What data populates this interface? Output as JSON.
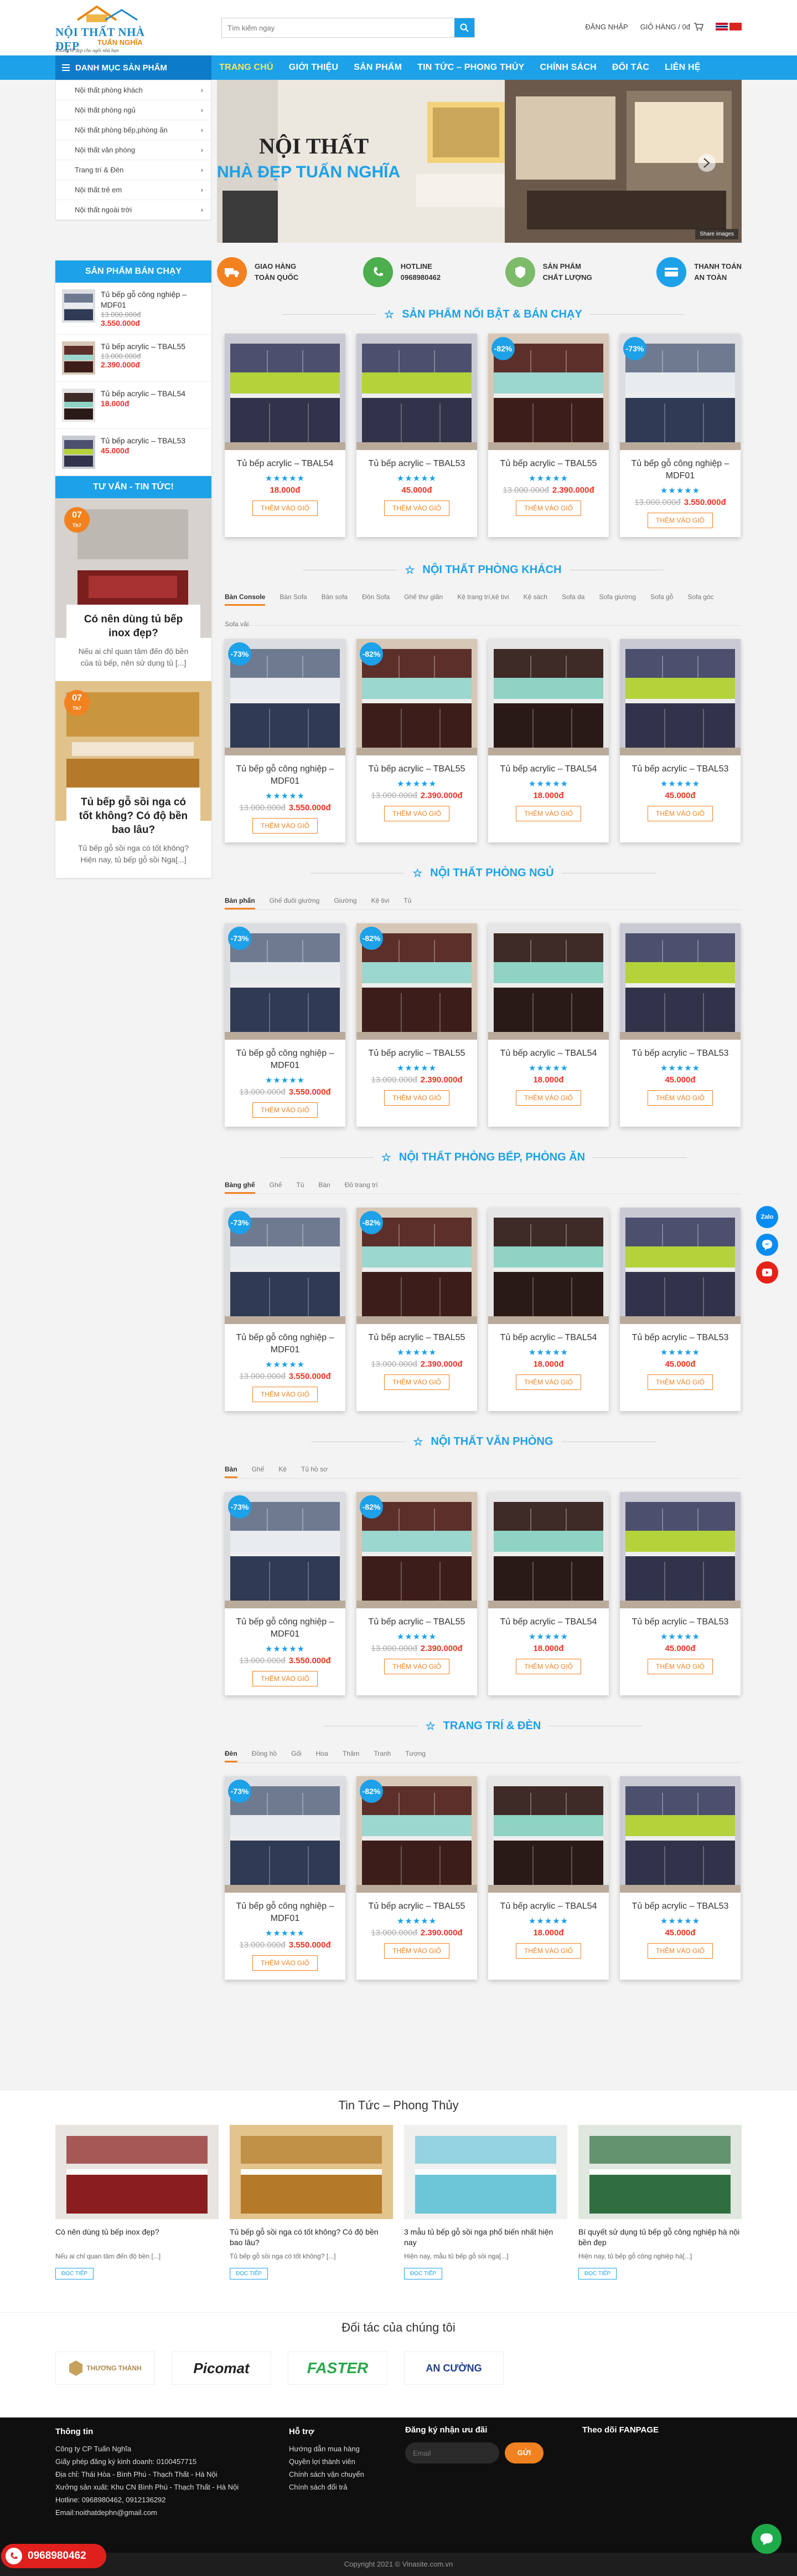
{
  "header": {
    "logo_title": "NỘI THẤT NHÀ ĐẸP",
    "logo_sub": "TUẤN NGHĨA",
    "logo_slogan": "Không về đẹp cho ngôi nhà bạn",
    "search_placeholder": "Tìm kiếm ngay",
    "login": "ĐĂNG NHẬP",
    "cart": "GIỎ HÀNG / 0đ"
  },
  "nav": {
    "categories_btn": "DANH MỤC SẢN PHẨM",
    "items": [
      "TRANG CHỦ",
      "GIỚI THIỆU",
      "SẢN PHẨM",
      "TIN TỨC – PHONG THỦY",
      "CHÍNH SÁCH",
      "ĐỐI TÁC",
      "LIÊN HỆ"
    ]
  },
  "categories": [
    "Nội thất phòng khách",
    "Nội thất phòng ngủ",
    "Nội thất phòng bếp,phòng ăn",
    "Nội thất văn phòng",
    "Trang trí & Đèn",
    "Nội thất trẻ em",
    "Nội thất ngoài trời"
  ],
  "slider": {
    "title": "NỘI THẤT",
    "subtitle": "NHÀ ĐẸP TUẤN NGHĨA",
    "share": "Share images"
  },
  "features": [
    {
      "l1": "GIAO HÀNG",
      "l2": "TOÀN QUỐC",
      "color": "#f28220"
    },
    {
      "l1": "HOTLINE",
      "l2": "0968980462",
      "color": "#4cae4c"
    },
    {
      "l1": "SẢN PHẨM",
      "l2": "CHẤT LƯỢNG",
      "color": "#7dbb6a"
    },
    {
      "l1": "THANH TOÁN",
      "l2": "AN TOÀN",
      "color": "#1da1e8"
    }
  ],
  "sidebar": {
    "best_title": "SẢN PHẨM BÁN CHẠY",
    "best": [
      {
        "name": "Tủ bếp gỗ công nghiệp – MDF01",
        "old": "13.000.000đ",
        "price": "3.550.000đ"
      },
      {
        "name": "Tủ bếp acrylic – TBAL55",
        "old": "13.000.000đ",
        "price": "2.390.000đ"
      },
      {
        "name": "Tủ bếp acrylic – TBAL54",
        "old": "",
        "price": "18.000đ"
      },
      {
        "name": "Tủ bếp acrylic – TBAL53",
        "old": "",
        "price": "45.000đ"
      }
    ],
    "news_title": "TƯ VẤN - TIN TỨC!",
    "news": [
      {
        "day": "07",
        "mon": "Th7",
        "title": "Có nên dùng tủ bếp inox đẹp?",
        "excerpt": "Nếu ai chỉ quan tâm đến độ bền của tủ bếp, nên sử dụng tủ [...]"
      },
      {
        "day": "07",
        "mon": "Th7",
        "title": "Tủ bếp gỗ sồi nga có tốt không? Có độ bền bao lâu?",
        "excerpt": "Tủ bếp gỗ sồi nga có tốt không? Hiện nay, tủ bếp gỗ sồi Nga[...]"
      }
    ]
  },
  "hot": {
    "title": "SẢN PHẨM NỔI BẬT & BÁN CHẠY",
    "items": [
      {
        "name": "Tủ bếp acrylic – TBAL54",
        "old": "",
        "price": "18.000đ",
        "badge": ""
      },
      {
        "name": "Tủ bếp acrylic – TBAL53",
        "old": "",
        "price": "45.000đ",
        "badge": ""
      },
      {
        "name": "Tủ bếp acrylic – TBAL55",
        "old": "13.000.000đ",
        "price": "2.390.000đ",
        "badge": "-82%"
      },
      {
        "name": "Tủ bếp gỗ công nghiệp – MDF01",
        "old": "13.000.000đ",
        "price": "3.550.000đ",
        "badge": "-73%"
      }
    ]
  },
  "sections": [
    {
      "title": "NỘI THẤT PHÒNG KHÁCH",
      "tabs": [
        "Bàn Console",
        "Bàn Sofa",
        "Bàn sofa",
        "Đôn Sofa",
        "Ghế thư giãn",
        "Kệ trang trí,kệ tivi",
        "Kệ sách",
        "Sofa da",
        "Sofa giường",
        "Sofa gỗ",
        "Sofa góc",
        "Sofa vải"
      ]
    },
    {
      "title": "NỘI THẤT PHÒNG NGỦ",
      "tabs": [
        "Bàn phấn",
        "Ghế đuôi giường",
        "Giường",
        "Kệ tivi",
        "Tủ"
      ]
    },
    {
      "title": "NỘI THẤT PHÒNG BẾP, PHÒNG ĂN",
      "tabs": [
        "Bàng ghế",
        "Ghế",
        "Tủ",
        "Bàn",
        "Đồ trang trí"
      ]
    },
    {
      "title": "NỘI THẤT VĂN PHÒNG",
      "tabs": [
        "Bàn",
        "Ghế",
        "Kệ",
        "Tủ hồ sơ"
      ]
    },
    {
      "title": "TRANG TRÍ & ĐÈN",
      "tabs": [
        "Đèn",
        "Đồng hồ",
        "Gối",
        "Hoa",
        "Thảm",
        "Tranh",
        "Tượng"
      ]
    }
  ],
  "products": [
    {
      "name": "Tủ bếp gỗ công nghiệp – MDF01",
      "old": "13.000.000đ",
      "price": "3.550.000đ",
      "badge": "-73%"
    },
    {
      "name": "Tủ bếp acrylic – TBAL55",
      "old": "13.000.000đ",
      "price": "2.390.000đ",
      "badge": "-82%"
    },
    {
      "name": "Tủ bếp acrylic – TBAL54",
      "old": "",
      "price": "18.000đ",
      "badge": ""
    },
    {
      "name": "Tủ bếp acrylic – TBAL53",
      "old": "",
      "price": "45.000đ",
      "badge": ""
    }
  ],
  "add_to_cart": "THÊM VÀO GIỎ",
  "stars": "★★★★★",
  "newsbot": {
    "title": "Tin Tức – Phong Thủy",
    "read": "ĐỌC TIẾP",
    "items": [
      {
        "title": "Có nên dùng tủ bếp inox đẹp?",
        "excerpt": "Nếu ai chỉ quan tâm đến độ bền [...]"
      },
      {
        "title": "Tủ bếp gỗ sồi nga có tốt không? Có độ bền bao lâu?",
        "excerpt": "Tủ bếp gỗ sồi nga có tốt không? [...]"
      },
      {
        "title": "3 mẫu tủ bếp gỗ sồi nga phổ biến nhất hiện nay",
        "excerpt": "Hiện nay, mẫu tủ bếp gỗ sồi nga[...]"
      },
      {
        "title": "Bí quyết sử dụng tủ bếp gỗ công nghiệp hà nội bền đẹp",
        "excerpt": "Hiện nay, tủ bếp gỗ công nghiệp hà[...]"
      }
    ]
  },
  "partners": {
    "title": "Đối tác của chúng tôi",
    "names": [
      "THƯƠNG THÀNH",
      "Picomat",
      "FASTER",
      "AN CƯỜNG"
    ]
  },
  "footer": {
    "info_title": "Thông tin",
    "company": "Công ty CP Tuấn Nghĩa",
    "license": "Giấy phép đăng ký kinh doanh: 0100457715",
    "address": "Địa chỉ: Thái Hòa - Bình Phú - Thạch Thất - Hà Nội",
    "workshop": "Xưởng sản xuất: Khu CN Bình Phú - Thạch Thất - Hà Nội",
    "hotline": "Hotline: 0968980462, 0912136292",
    "email": "Email:noithatdephn@gmail.com",
    "support_title": "Hỗ trợ",
    "support": [
      "Hướng dẫn mua hàng",
      "Quyền lợi thành viên",
      "Chính sách vận chuyển",
      "Chính sách đổi trả"
    ],
    "subscribe_title": "Đăng ký nhận ưu đãi",
    "email_placeholder": "Email",
    "send": "GỬI",
    "fanpage": "Theo dõi FANPAGE",
    "copyright": "Copyright 2021 © Vinasite.com.vn",
    "hotline_btn": "0968980462"
  }
}
